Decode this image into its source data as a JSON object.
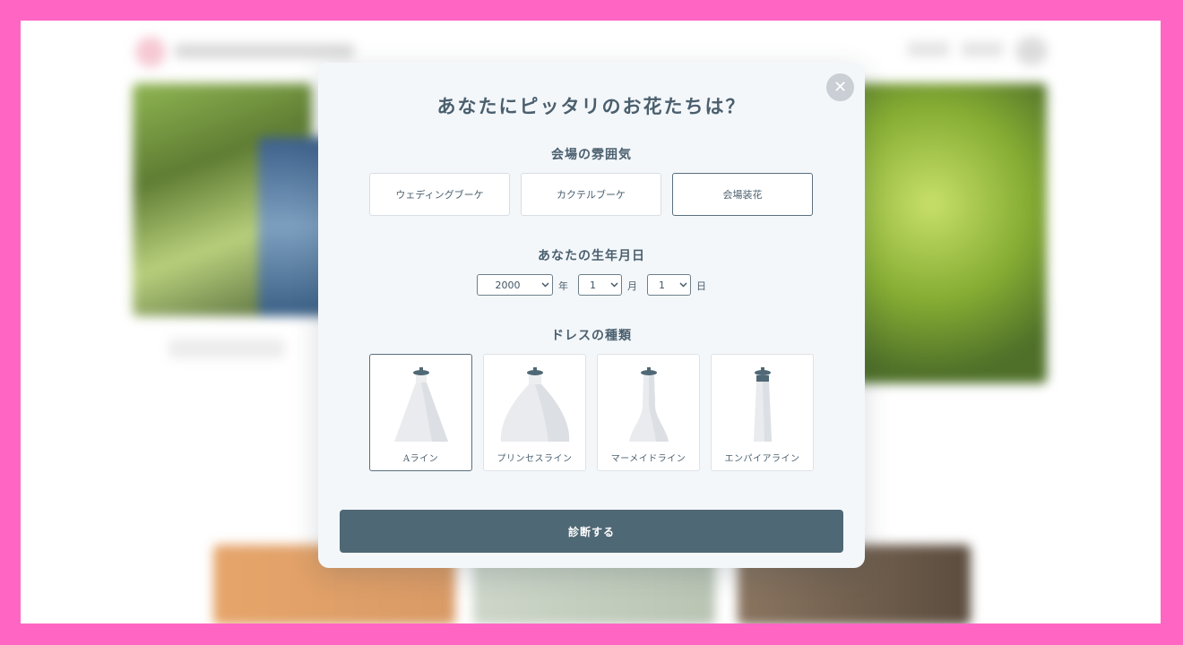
{
  "modal": {
    "title": "あなたにピッタリのお花たちは？",
    "close_icon": "close-icon"
  },
  "scene": {
    "label": "会場の雰囲気",
    "options": [
      "ウェディングブーケ",
      "カクテルブーケ",
      "会場装花"
    ],
    "selected_index": 2
  },
  "birthday": {
    "label": "あなたの生年月日",
    "year": "2000",
    "year_unit": "年",
    "month": "1",
    "month_unit": "月",
    "day": "1",
    "day_unit": "日"
  },
  "dress": {
    "label": "ドレスの種類",
    "options": [
      "Aライン",
      "プリンセスライン",
      "マーメイドライン",
      "エンパイアライン"
    ],
    "selected_index": 0
  },
  "submit_label": "診断する",
  "colors": {
    "frame": "#ff66c4",
    "accent": "#4f6875",
    "modal_bg": "#f4f7fa"
  }
}
